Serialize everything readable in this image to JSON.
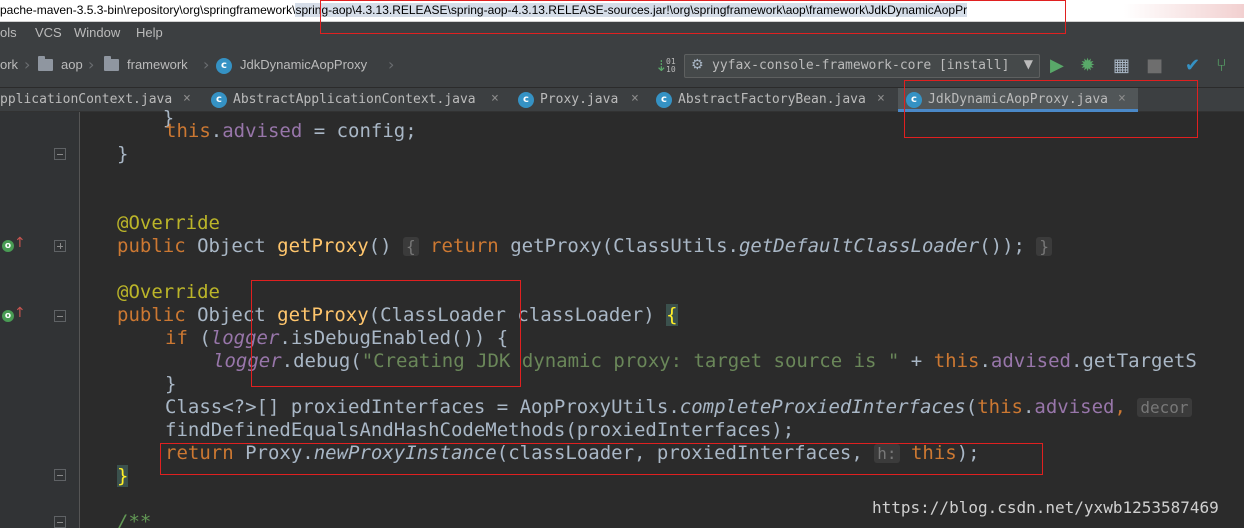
{
  "window": {
    "title_path_prefix": "pache-maven-3.5.3-bin\\repository\\org\\springframework\\",
    "title_path_selected": "spring-aop\\4.3.13.RELEASE\\spring-aop-4.3.13.RELEASE-sources.jar!\\org\\springframework\\aop\\framework\\JdkDynamicAopPr"
  },
  "menu": [
    "ols",
    "VCS",
    "Window",
    "Help"
  ],
  "breadcrumbs": [
    "ork",
    "aop",
    "framework",
    "JdkDynamicAopProxy"
  ],
  "run_config": "yyfax-console-framework-core [install]",
  "tabs": [
    {
      "label": "pplicationContext.java",
      "active": false
    },
    {
      "label": "AbstractApplicationContext.java",
      "active": false
    },
    {
      "label": "Proxy.java",
      "active": false
    },
    {
      "label": "AbstractFactoryBean.java",
      "active": false
    },
    {
      "label": "JdkDynamicAopProxy.java",
      "active": true
    }
  ],
  "code": {
    "l1_this": "this",
    "l1_field": "advised",
    "l1_rest": " = config;",
    "l2": "}",
    "l3_annotation": "@Override",
    "l4_public": "public",
    "l4_type": " Object ",
    "l4_fn": "getProxy",
    "l4_parens": "()",
    "l4_open": "{",
    "l4_return": "return",
    "l4_call": " getProxy(ClassUtils.",
    "l4_method": "getDefaultClassLoader",
    "l4_end": "());",
    "l4_close": "}",
    "l5_annotation": "@Override",
    "l6_public": "public",
    "l6_type": " Object ",
    "l6_fn": "getProxy",
    "l6_params": "(ClassLoader classLoader) ",
    "l6_brace": "{",
    "l7_if": "if",
    "l7_open": " (",
    "l7_logger": "logger",
    "l7_rest": ".isDebugEnabled()) {",
    "l8_logger": "logger",
    "l8_call": ".debug(",
    "l8_string": "\"Creating JDK dynamic proxy: target source is \"",
    "l8_plus": " + ",
    "l8_this": "this",
    "l8_dot": ".",
    "l8_field": "advised",
    "l8_rest": ".getTargetS",
    "l9": "}",
    "l10_decl": "Class<?>[] proxiedInterfaces = AopProxyUtils.",
    "l10_method": "completeProxiedInterfaces",
    "l10_open": "(",
    "l10_this": "this",
    "l10_dot": ".",
    "l10_field": "advised",
    "l10_comma": ", ",
    "l10_hint": "decor",
    "l11": "findDefinedEqualsAndHashCodeMethods(proxiedInterfaces);",
    "l12_return": "return",
    "l12_class": " Proxy.",
    "l12_method": "newProxyInstance",
    "l12_args": "(classLoader, proxiedInterfaces, ",
    "l12_hint": "h:",
    "l12_this": "this",
    "l12_end": ");",
    "l13_brace": "}",
    "l14_comment": "/**"
  },
  "watermark": "https://blog.csdn.net/yxwb1253587469",
  "colors": {
    "keyword": "#cc7832",
    "annotation": "#bbb529",
    "method_decl": "#ffc66d",
    "field": "#9876aa",
    "string": "#6a8759",
    "highlight_box": "#e02020"
  }
}
